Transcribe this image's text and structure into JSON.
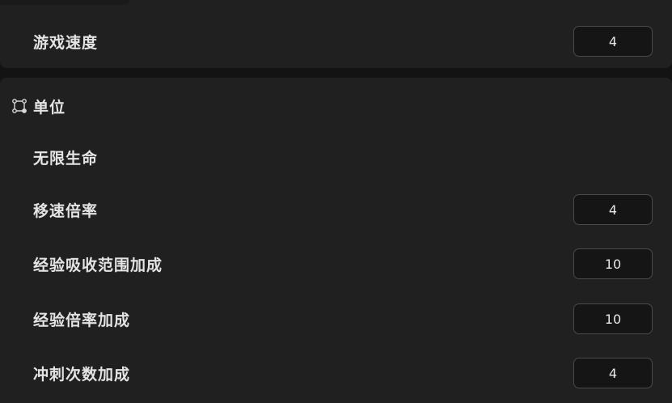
{
  "top_panel": {
    "game_speed": {
      "label": "游戏速度",
      "value": "4"
    }
  },
  "units_section": {
    "title": "单位",
    "icon": "nodes-icon",
    "items": [
      {
        "label": "无限生命"
      },
      {
        "label": "移速倍率",
        "value": "4"
      },
      {
        "label": "经验吸收范围加成",
        "value": "10"
      },
      {
        "label": "经验倍率加成",
        "value": "10"
      },
      {
        "label": "冲刺次数加成",
        "value": "4"
      }
    ]
  }
}
